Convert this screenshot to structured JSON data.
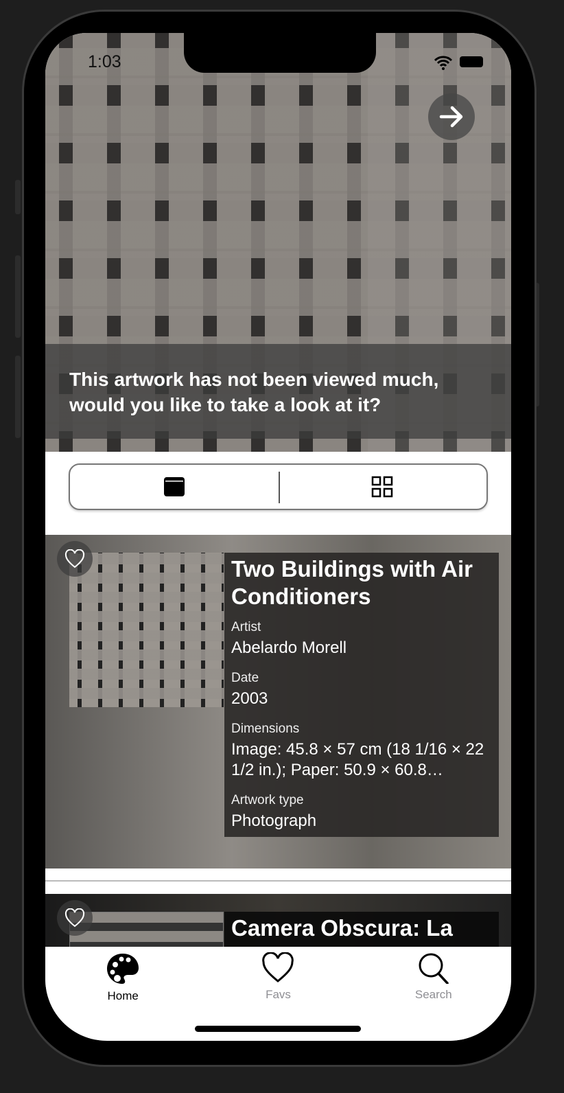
{
  "status": {
    "time": "1:03"
  },
  "hero": {
    "banner_text": "This artwork has not been viewed much, would you like to take a look at it?"
  },
  "view_toggle": {
    "options": [
      "single-view",
      "grid-view"
    ],
    "selected": "single-view"
  },
  "artworks": [
    {
      "title": "Two Buildings with Air Conditioners",
      "artist_label": "Artist",
      "artist": "Abelardo Morell",
      "date_label": "Date",
      "date": "2003",
      "dimensions_label": "Dimensions",
      "dimensions": "Image: 45.8 × 57 cm (18 1/16 × 22 1/2 in.); Paper: 50.9 × 60.8…",
      "type_label": "Artwork type",
      "type": "Photograph"
    },
    {
      "title": "Camera Obscura: La"
    }
  ],
  "tabs": [
    {
      "label": "Home",
      "active": true
    },
    {
      "label": "Favs"
    },
    {
      "label": "Search"
    }
  ],
  "colors": {
    "tab_active": "#000000",
    "tab_inactive": "#8e8e93"
  }
}
